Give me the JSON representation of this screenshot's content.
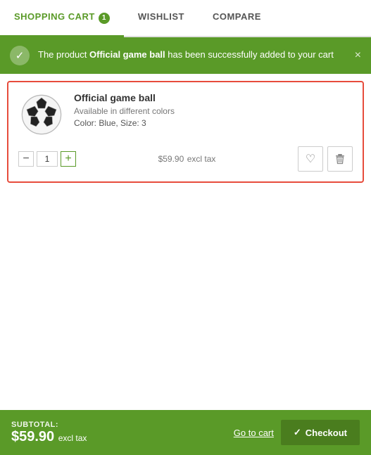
{
  "tabs": [
    {
      "id": "shopping-cart",
      "label": "SHOPPING CART",
      "badge": 1,
      "active": true
    },
    {
      "id": "wishlist",
      "label": "WISHLIST",
      "badge": null,
      "active": false
    },
    {
      "id": "compare",
      "label": "COMPARE",
      "badge": null,
      "active": false
    }
  ],
  "banner": {
    "message_prefix": "The product ",
    "product_name": "Official game ball",
    "message_suffix": " has been successfully added to your cart"
  },
  "cart": {
    "item": {
      "name": "Official game ball",
      "subtitle": "Available in different colors",
      "options": "Color: Blue, Size: 3",
      "price": "$59.90",
      "price_suffix": "excl tax",
      "quantity": 1
    }
  },
  "footer": {
    "subtotal_label": "SUBTOTAL:",
    "subtotal_amount": "$59.90",
    "subtotal_suffix": "excl tax",
    "go_to_cart_label": "Go to cart",
    "checkout_label": "Checkout"
  },
  "icons": {
    "checkmark": "✓",
    "close": "×",
    "minus": "−",
    "plus": "+",
    "heart": "♡",
    "trash": "🗑"
  }
}
